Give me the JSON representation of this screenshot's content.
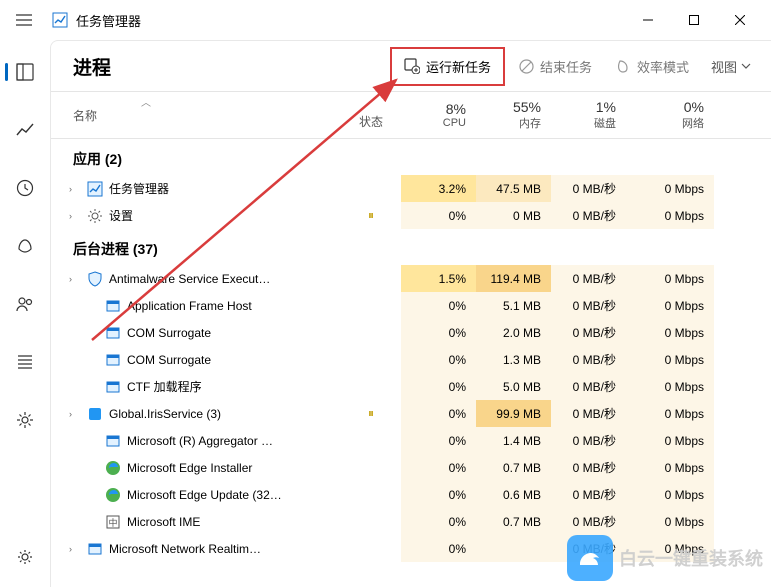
{
  "window": {
    "title": "任务管理器"
  },
  "sidebar": {
    "items": [
      "processes",
      "performance",
      "history",
      "startup",
      "users",
      "details",
      "services"
    ],
    "bottom": "settings"
  },
  "toolbar": {
    "page_title": "进程",
    "run_new_task": "运行新任务",
    "end_task": "结束任务",
    "efficiency_mode": "效率模式",
    "view_label": "视图"
  },
  "headers": {
    "name": "名称",
    "status": "状态",
    "cpu_pct": "8%",
    "cpu_label": "CPU",
    "mem_pct": "55%",
    "mem_label": "内存",
    "disk_pct": "1%",
    "disk_label": "磁盘",
    "net_pct": "0%",
    "net_label": "网络"
  },
  "groups": {
    "apps": "应用 (2)",
    "background": "后台进程 (37)"
  },
  "rows": [
    {
      "g": "apps",
      "name": "任务管理器",
      "exp": true,
      "status": "",
      "cpu": "3.2%",
      "mem": "47.5 MB",
      "disk": "0 MB/秒",
      "net": "0 Mbps",
      "cpu_h": "heat-cpu-on",
      "mem_h": "heat-med",
      "icon": "tm"
    },
    {
      "g": "apps",
      "name": "设置",
      "exp": true,
      "status": "paused",
      "cpu": "0%",
      "mem": "0 MB",
      "disk": "0 MB/秒",
      "net": "0 Mbps",
      "cpu_h": "heat-low",
      "mem_h": "heat-low",
      "icon": "gear"
    },
    {
      "g": "bg",
      "name": "Antimalware Service Execut…",
      "exp": true,
      "status": "",
      "cpu": "1.5%",
      "mem": "119.4 MB",
      "disk": "0 MB/秒",
      "net": "0 Mbps",
      "cpu_h": "heat-cpu-on",
      "mem_h": "heat-high",
      "icon": "shield"
    },
    {
      "g": "bg",
      "name": "Application Frame Host",
      "exp": false,
      "status": "",
      "cpu": "0%",
      "mem": "5.1 MB",
      "disk": "0 MB/秒",
      "net": "0 Mbps",
      "cpu_h": "heat-low",
      "mem_h": "heat-low",
      "icon": "app"
    },
    {
      "g": "bg",
      "name": "COM Surrogate",
      "exp": false,
      "status": "",
      "cpu": "0%",
      "mem": "2.0 MB",
      "disk": "0 MB/秒",
      "net": "0 Mbps",
      "cpu_h": "heat-low",
      "mem_h": "heat-low",
      "icon": "app"
    },
    {
      "g": "bg",
      "name": "COM Surrogate",
      "exp": false,
      "status": "",
      "cpu": "0%",
      "mem": "1.3 MB",
      "disk": "0 MB/秒",
      "net": "0 Mbps",
      "cpu_h": "heat-low",
      "mem_h": "heat-low",
      "icon": "app"
    },
    {
      "g": "bg",
      "name": "CTF 加载程序",
      "exp": false,
      "status": "",
      "cpu": "0%",
      "mem": "5.0 MB",
      "disk": "0 MB/秒",
      "net": "0 Mbps",
      "cpu_h": "heat-low",
      "mem_h": "heat-low",
      "icon": "app"
    },
    {
      "g": "bg",
      "name": "Global.IrisService (3)",
      "exp": true,
      "status": "paused",
      "cpu": "0%",
      "mem": "99.9 MB",
      "disk": "0 MB/秒",
      "net": "0 Mbps",
      "cpu_h": "heat-low",
      "mem_h": "heat-high",
      "icon": "blue"
    },
    {
      "g": "bg",
      "name": "Microsoft (R) Aggregator …",
      "exp": false,
      "status": "",
      "cpu": "0%",
      "mem": "1.4 MB",
      "disk": "0 MB/秒",
      "net": "0 Mbps",
      "cpu_h": "heat-low",
      "mem_h": "heat-low",
      "icon": "app"
    },
    {
      "g": "bg",
      "name": "Microsoft Edge Installer",
      "exp": false,
      "status": "",
      "cpu": "0%",
      "mem": "0.7 MB",
      "disk": "0 MB/秒",
      "net": "0 Mbps",
      "cpu_h": "heat-low",
      "mem_h": "heat-low",
      "icon": "edge"
    },
    {
      "g": "bg",
      "name": "Microsoft Edge Update (32…",
      "exp": false,
      "status": "",
      "cpu": "0%",
      "mem": "0.6 MB",
      "disk": "0 MB/秒",
      "net": "0 Mbps",
      "cpu_h": "heat-low",
      "mem_h": "heat-low",
      "icon": "edge"
    },
    {
      "g": "bg",
      "name": "Microsoft IME",
      "exp": false,
      "status": "",
      "cpu": "0%",
      "mem": "0.7 MB",
      "disk": "0 MB/秒",
      "net": "0 Mbps",
      "cpu_h": "heat-low",
      "mem_h": "heat-low",
      "icon": "ime"
    },
    {
      "g": "bg",
      "name": "Microsoft Network Realtim…",
      "exp": true,
      "status": "",
      "cpu": "0%",
      "mem": "",
      "disk": "0 MB/秒",
      "net": "0 Mbps",
      "cpu_h": "heat-low",
      "mem_h": "heat-low",
      "icon": "app"
    }
  ],
  "watermark": "白云一键重装系统"
}
